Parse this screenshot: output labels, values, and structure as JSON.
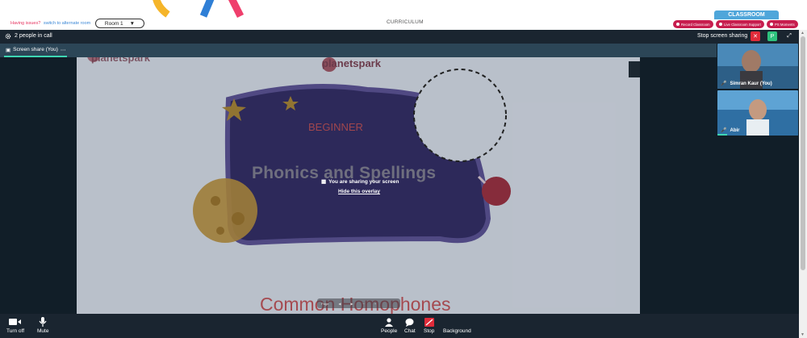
{
  "header": {
    "issues_text": "Having issues?",
    "alternate_room_link": "switch to alternate room",
    "room_selected": "Room 1",
    "curriculum_label": "CURRICULUM",
    "classroom_tab": "CLASSROOM",
    "pills": {
      "record": "Record Classroom",
      "support": "Live Classroom Support",
      "moments": "PS Moments"
    }
  },
  "callbar": {
    "people_count": "2 people in call",
    "stop_sharing": "Stop screen sharing",
    "participant_initial": "P"
  },
  "share_tab": {
    "label": "Screen share (You)",
    "more": "⋯"
  },
  "slide": {
    "brand": "planetspark",
    "level": "BEGINNER",
    "title": "Phonics and Spellings",
    "subtitle": "Common Homophones",
    "sharing_message": "You are sharing your screen",
    "hide_overlay": "Hide this overlay",
    "pager_label": "Page"
  },
  "videos": [
    {
      "name": "Simran Kaur (You)"
    },
    {
      "name": "Abir"
    }
  ],
  "controls": {
    "turn_off": "Turn off",
    "mute": "Mute",
    "people": "People",
    "chat": "Chat",
    "stop": "Stop",
    "background": "Background"
  },
  "colors": {
    "dark_bar": "#1a2530",
    "accent_teal": "#3ed6b3",
    "pill_red": "#c71d4e",
    "classroom_blue": "#4fa6da",
    "slide_blob": "#2f2a5e"
  },
  "icons": [
    "gear-icon",
    "close-icon",
    "expand-icon",
    "camera-icon",
    "mic-icon",
    "person-icon",
    "chat-icon",
    "stop-share-icon",
    "background-icon",
    "screen-share-icon"
  ]
}
